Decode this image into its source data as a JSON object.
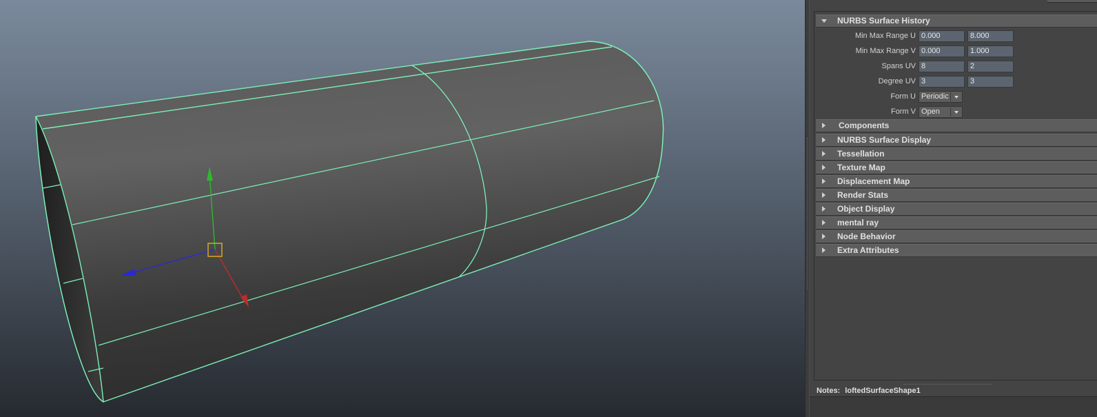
{
  "viewport": {
    "accent_curve_color": "#7cf0b8",
    "manip_colors": {
      "x": "#c02a2a",
      "y": "#2eb82e",
      "z": "#2a2ad0",
      "center": "#e0b020"
    }
  },
  "attribute_editor": {
    "expanded_section": {
      "title": "NURBS Surface History",
      "rows": [
        {
          "label": "Min Max Range U",
          "v1": "0.000",
          "v2": "8.000"
        },
        {
          "label": "Min Max Range V",
          "v1": "0.000",
          "v2": "1.000"
        },
        {
          "label": "Spans UV",
          "v1": "8",
          "v2": "2"
        },
        {
          "label": "Degree UV",
          "v1": "3",
          "v2": "3"
        }
      ],
      "form_u": {
        "label": "Form U",
        "value": "Periodic"
      },
      "form_v": {
        "label": "Form V",
        "value": "Open"
      }
    },
    "collapsed_sections": [
      "Components",
      "NURBS Surface Display",
      "Tessellation",
      "Texture Map",
      "Displacement Map",
      "Render Stats",
      "Object Display",
      "mental ray",
      "Node Behavior",
      "Extra Attributes"
    ],
    "notes": {
      "label": "Notes:",
      "node_name": "loftedSurfaceShape1"
    }
  }
}
